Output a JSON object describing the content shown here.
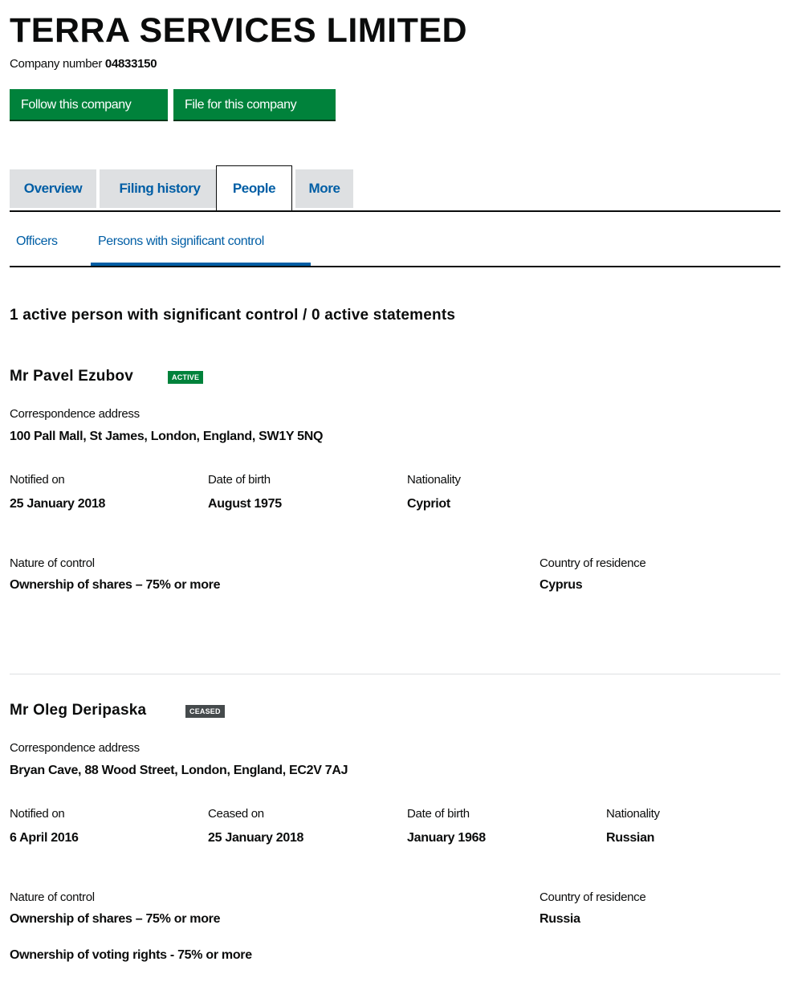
{
  "company": {
    "name": "TERRA SERVICES LIMITED",
    "number_label": "Company number",
    "number": "04833150"
  },
  "actions": {
    "follow": "Follow this company",
    "file": "File for this company"
  },
  "tabs": [
    "Overview",
    "Filing history",
    "People",
    "More"
  ],
  "active_tab": "People",
  "subtabs": [
    "Officers",
    "Persons with significant control"
  ],
  "active_subtab": "Persons with significant control",
  "summary": "1 active person with significant control / 0 active statements",
  "persons": [
    {
      "name": "Mr Pavel Ezubov",
      "status": "ACTIVE",
      "address_label": "Correspondence address",
      "address": "100 Pall Mall, St James, London, England, SW1Y 5NQ",
      "notified_label": "Notified on",
      "notified": "25 January 2018",
      "dob_label": "Date of birth",
      "dob": "August 1975",
      "nationality_label": "Nationality",
      "nationality": "Cypriot",
      "control_label": "Nature of control",
      "control": [
        "Ownership of shares – 75% or more"
      ],
      "residence_label": "Country of residence",
      "residence": "Cyprus"
    },
    {
      "name": "Mr Oleg Deripaska",
      "status": "CEASED",
      "address_label": "Correspondence address",
      "address": "Bryan Cave, 88 Wood Street, London, England, EC2V 7AJ",
      "notified_label": "Notified on",
      "notified": "6 April 2016",
      "ceased_label": "Ceased on",
      "ceased": "25 January 2018",
      "dob_label": "Date of birth",
      "dob": "January 1968",
      "nationality_label": "Nationality",
      "nationality": "Russian",
      "control_label": "Nature of control",
      "control": [
        "Ownership of shares – 75% or more",
        "Ownership of voting rights - 75% or more"
      ],
      "residence_label": "Country of residence",
      "residence": "Russia"
    }
  ],
  "colors": {
    "button_green": "#00823b",
    "link_blue": "#005ea5",
    "tab_grey": "#dee0e2",
    "ceased_grey": "#454a4c"
  }
}
